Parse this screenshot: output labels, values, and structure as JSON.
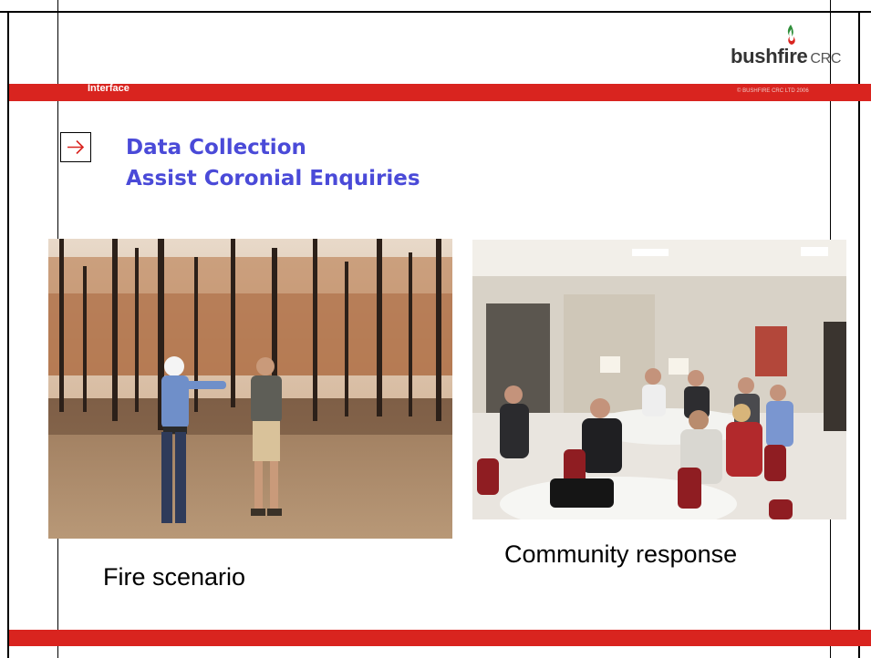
{
  "header": {
    "section_label": "Interface",
    "copyright": "© BUSHFIRE CRC LTD 2006",
    "logo": {
      "wordmark": "bushfire",
      "suffix": "CRC",
      "icon": "flame-icon"
    }
  },
  "content": {
    "bullet_icon": "right-arrow-icon",
    "heading_lines": [
      "Data Collection",
      "Assist Coronial Enquiries"
    ],
    "photos": [
      {
        "caption": "Fire scenario",
        "subject": "burnt-bushland-photo"
      },
      {
        "caption": "Community response",
        "subject": "community-meeting-photo"
      }
    ]
  },
  "colors": {
    "accent_red": "#d9241f",
    "heading_blue": "#4a4ad8"
  }
}
